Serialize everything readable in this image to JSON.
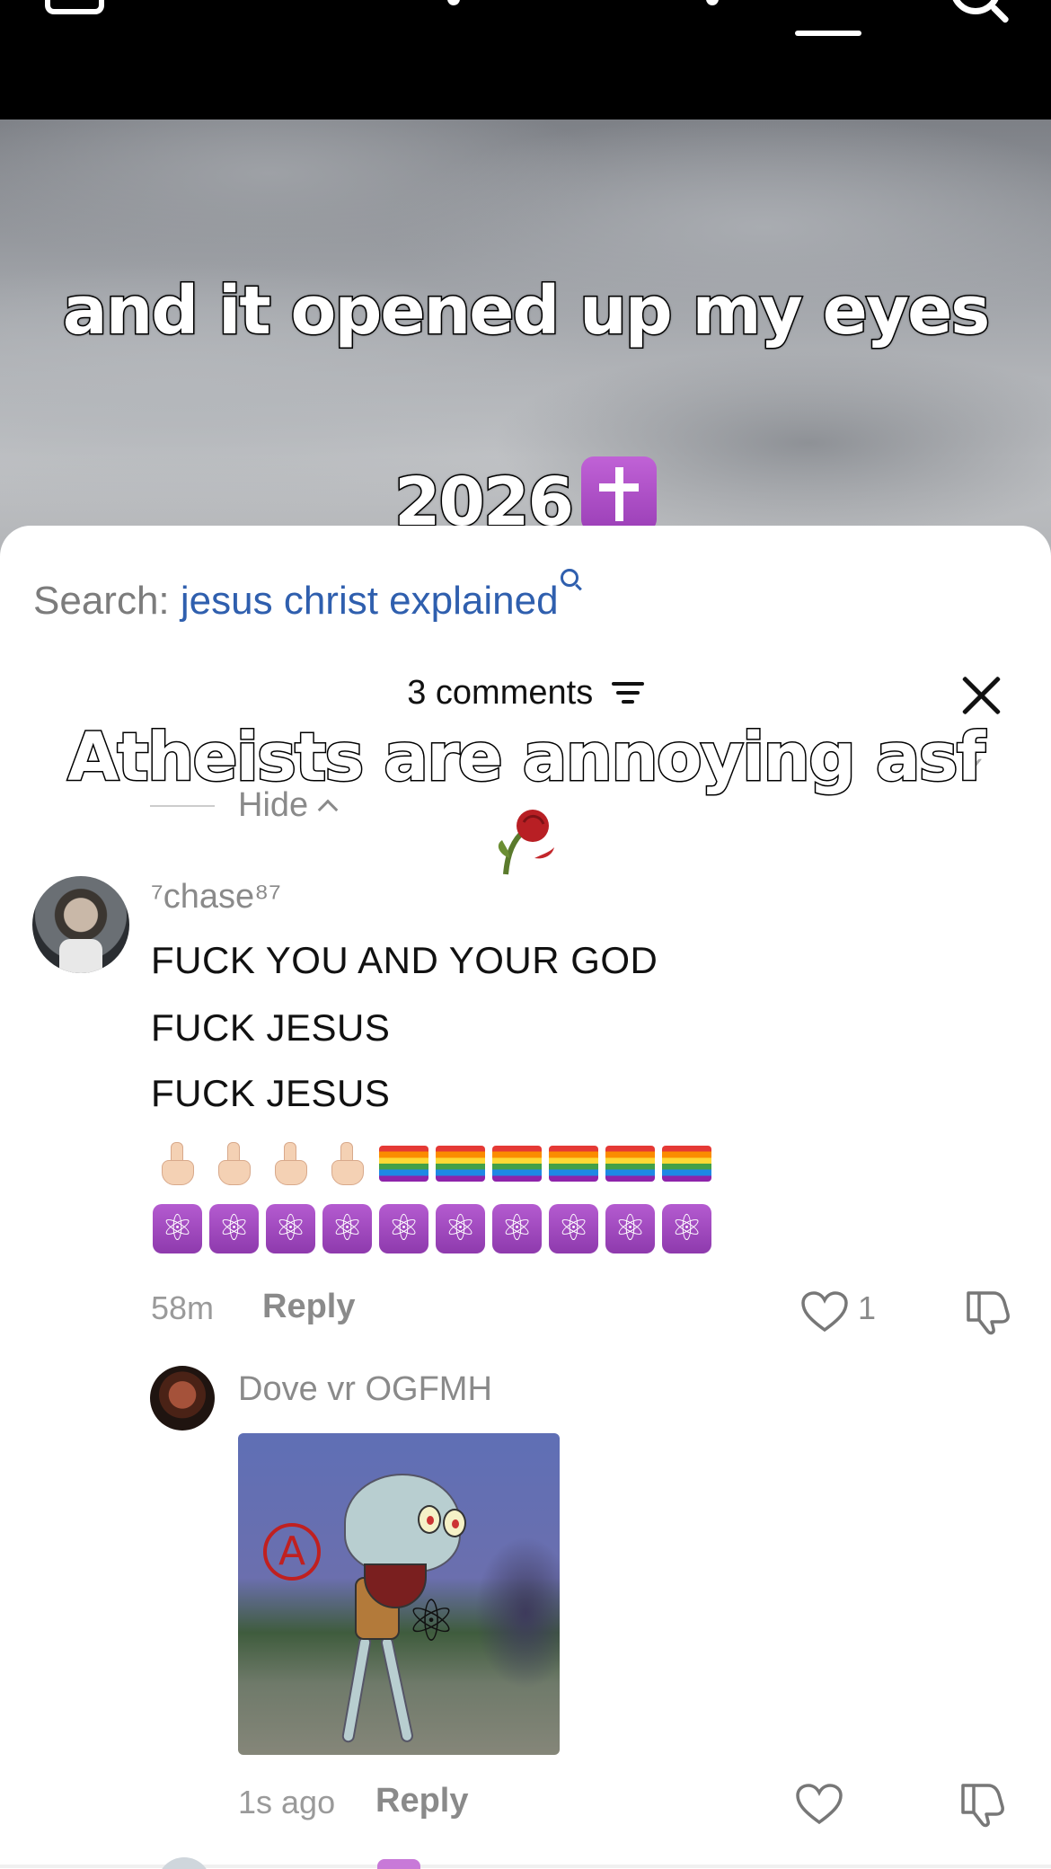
{
  "video": {
    "caption_line1": "and it opened up my eyes",
    "caption_line2": "2026",
    "overlay_caption": "Atheists are annoying asf"
  },
  "comments_sheet": {
    "search_label": "Search:",
    "search_query": "jesus christ explained",
    "header": "3 comments",
    "hide_label": "Hide"
  },
  "comment": {
    "username": "⁷chase⁸⁷",
    "lines": [
      "FUCK YOU AND YOUR GOD",
      "FUCK JESUS",
      "FUCK JESUS"
    ],
    "emoji_row1": [
      "middle-finger",
      "middle-finger",
      "middle-finger",
      "middle-finger",
      "rainbow-flag",
      "rainbow-flag",
      "rainbow-flag",
      "rainbow-flag",
      "rainbow-flag",
      "rainbow-flag"
    ],
    "emoji_row2_count": 10,
    "time": "58m",
    "reply_label": "Reply",
    "like_count": "1"
  },
  "reply": {
    "username": "Dove vr OGFMH",
    "time": "1s ago",
    "reply_label": "Reply"
  },
  "colors": {
    "search_query": "#2f5fae",
    "muted_text": "#8a8a8a",
    "emoji_purple": "#a24cc3"
  }
}
